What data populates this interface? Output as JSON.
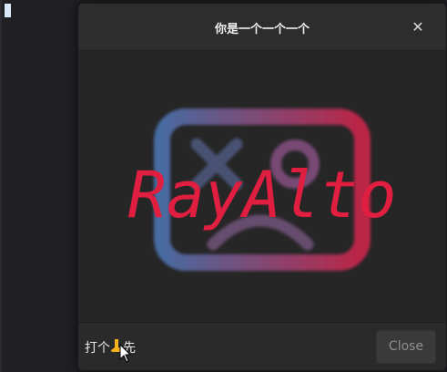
{
  "dialog": {
    "title": "你是一个一个一个",
    "close_icon": "close-icon",
    "footer_text_prefix": "打个",
    "footer_text_suffix": "先",
    "footer_icon": "foot-icon",
    "close_label": "Close"
  },
  "logo": {
    "text": "RayAlto",
    "text_color": "#e01e40",
    "gradient_start": "#4a6fa8",
    "gradient_end": "#c42548"
  }
}
